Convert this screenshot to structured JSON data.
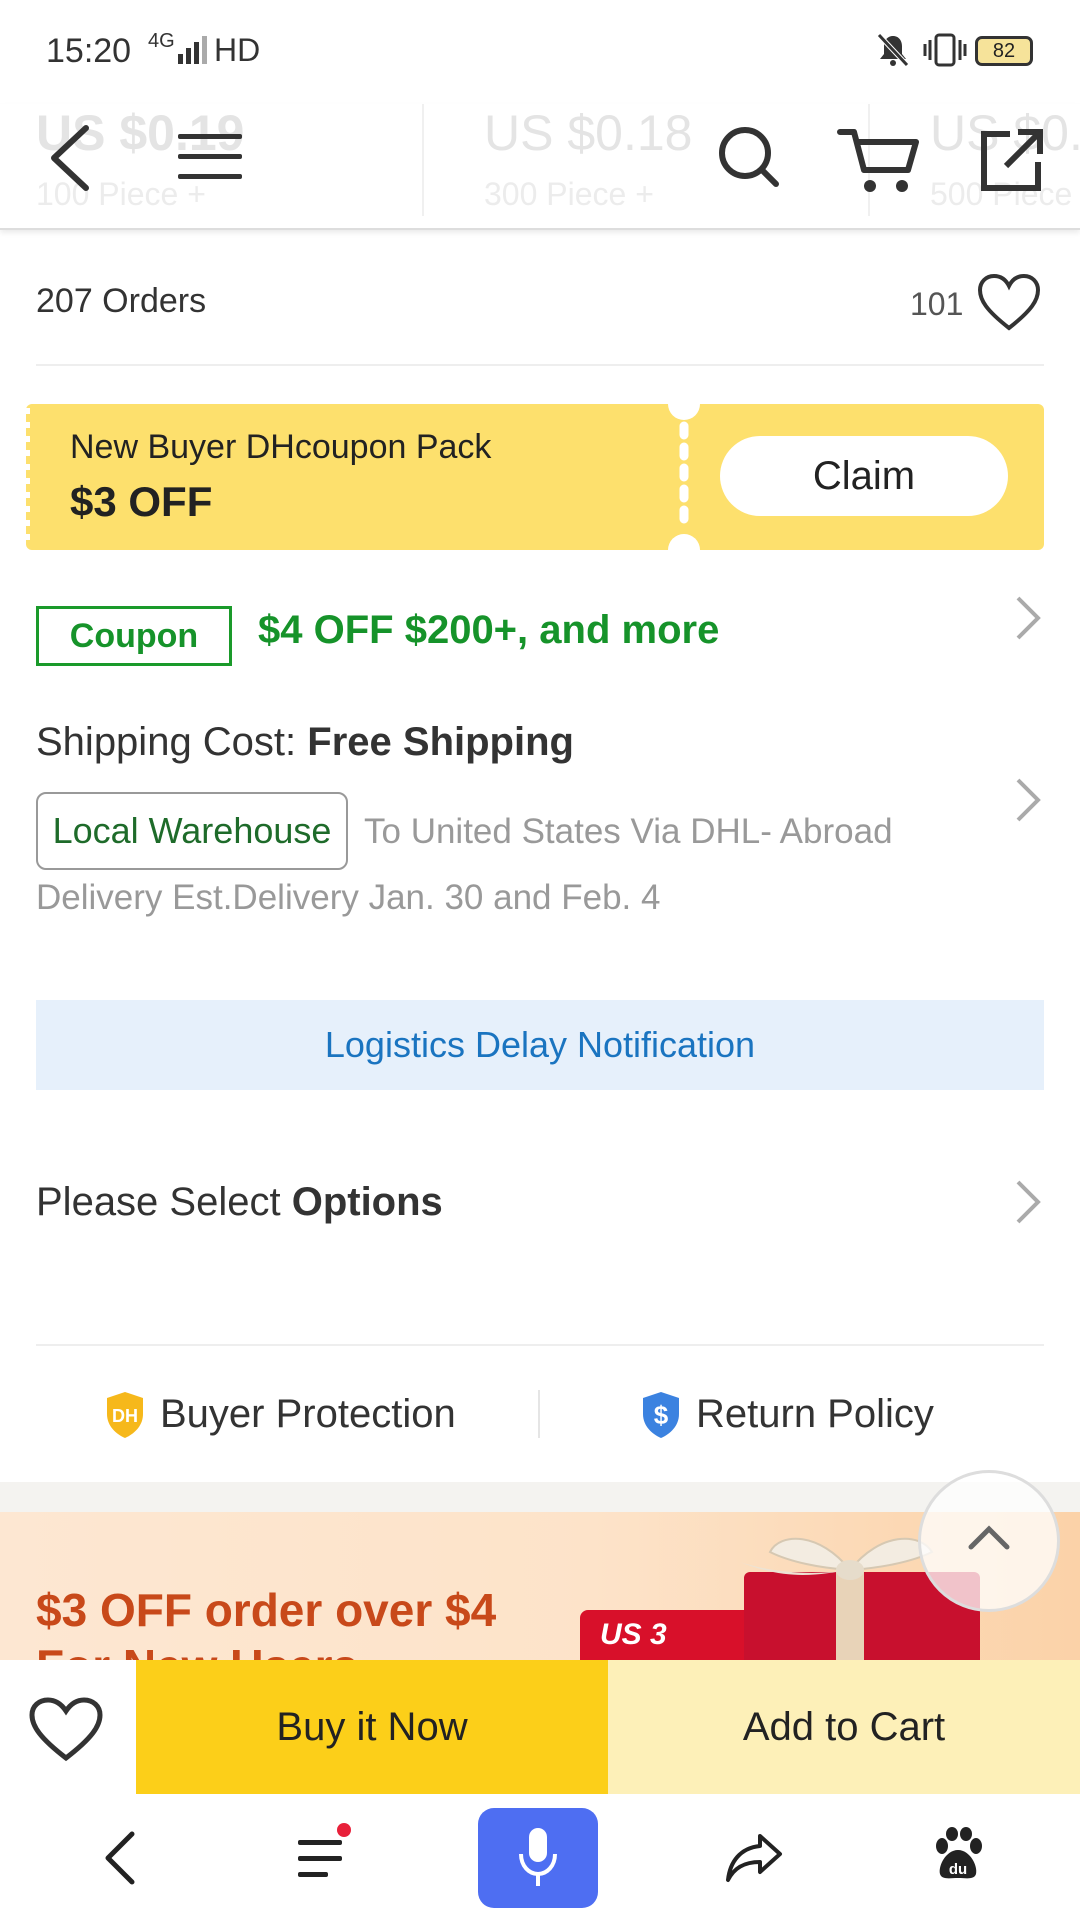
{
  "status_bar": {
    "time": "15:20",
    "network": "4G",
    "hd": "HD",
    "battery": "82"
  },
  "header": {
    "price_tiers": [
      {
        "price": "US $0.19",
        "qty": "100 Piece +"
      },
      {
        "price": "US $0.18",
        "qty": "300 Piece +"
      },
      {
        "price": "US $0.",
        "qty": "500 Piece"
      }
    ]
  },
  "product": {
    "orders": "207 Orders",
    "favorites_count": "101"
  },
  "coupon_pack": {
    "title": "New Buyer DHcoupon Pack",
    "amount": "$3 OFF",
    "claim_label": "Claim"
  },
  "coupon_row": {
    "badge": "Coupon",
    "text": "$4 OFF $200+, and more"
  },
  "shipping": {
    "label": "Shipping Cost: ",
    "value": "Free Shipping",
    "warehouse_tag": "Local Warehouse",
    "route": "To United States Via DHL- Abroad",
    "delivery": "Delivery Est.Delivery Jan. 30 and Feb. 4"
  },
  "logistics_notice": "Logistics Delay Notification",
  "options": {
    "prefix": "Please Select ",
    "bold": "Options"
  },
  "guarantees": {
    "buyer_protection": "Buyer Protection",
    "return_policy": "Return Policy"
  },
  "promo": {
    "line1": "$3 OFF order over $4",
    "line2": "For New Users",
    "badge": "US 3"
  },
  "actions": {
    "buy_now": "Buy it Now",
    "add_to_cart": "Add to Cart"
  },
  "colors": {
    "accent_yellow": "#fccf19",
    "coupon_green": "#16932a",
    "link_blue": "#1a74c0",
    "promo_orange": "#c8491a",
    "mic_blue": "#4e6ef2"
  }
}
